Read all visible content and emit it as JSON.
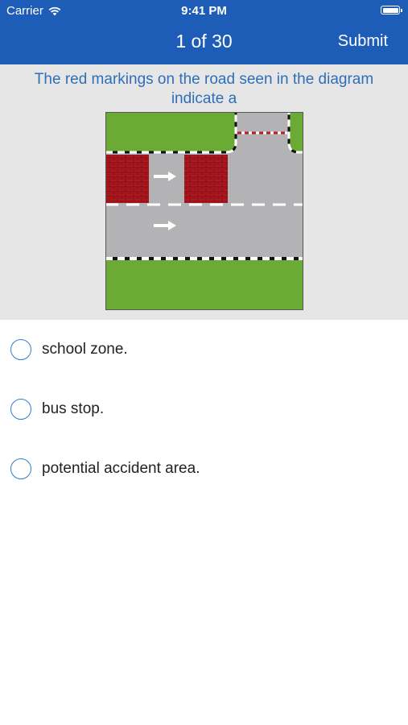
{
  "status_bar": {
    "carrier": "Carrier",
    "time": "9:41 PM"
  },
  "nav": {
    "title": "1 of 30",
    "submit_label": "Submit"
  },
  "question": {
    "text": "The red markings on the road seen in the diagram indicate a"
  },
  "answers": [
    {
      "label": "school zone.",
      "selected": false
    },
    {
      "label": "bus stop.",
      "selected": false
    },
    {
      "label": "potential accident area.",
      "selected": false
    }
  ],
  "colors": {
    "accent": "#1d5db7",
    "question_text": "#2f6fb8",
    "panel_bg": "#e6e6e6",
    "grass": "#6aaa35",
    "road": "#b3b3b5",
    "red_marking": "#b01820"
  }
}
